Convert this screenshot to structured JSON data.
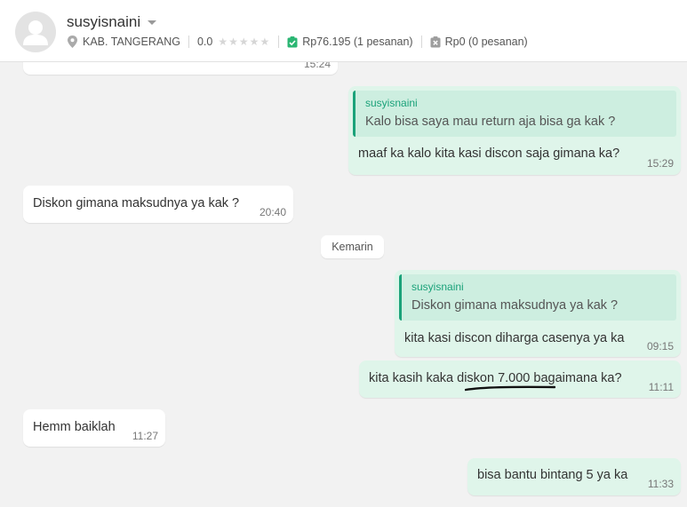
{
  "header": {
    "username": "susyisnaini",
    "location": "KAB. TANGERANG",
    "rating": "0.0",
    "completed": "Rp76.195 (1 pesanan)",
    "cancelled": "Rp0 (0 pesanan)"
  },
  "messages": [
    {
      "time": "15:24"
    },
    {
      "quote_name": "susyisnaini",
      "quote_text": "Kalo bisa saya mau return aja bisa ga kak ?",
      "text": "maaf ka kalo kita kasi discon saja gimana ka?",
      "time": "15:29"
    },
    {
      "text": "Diskon gimana maksudnya ya kak ?",
      "time": "20:40"
    },
    {
      "quote_name": "susyisnaini",
      "quote_text": "Diskon gimana maksudnya ya kak ?",
      "text": "kita kasi discon diharga casenya ya ka",
      "time": "09:15"
    },
    {
      "text": "kita kasih kaka diskon 7.000 bagaimana ka?",
      "time": "11:11"
    },
    {
      "text": "Hemm baiklah",
      "time": "11:27"
    },
    {
      "text": "bisa bantu bintang 5 ya ka",
      "time": "11:33"
    }
  ],
  "day_separator": "Kemarin",
  "colors": {
    "accent": "#1ba27a",
    "outgoing_bubble": "#dff5ea",
    "quote_bg": "#cdeee0",
    "incoming_bubble": "#ffffff",
    "background": "#f2f2f2"
  }
}
